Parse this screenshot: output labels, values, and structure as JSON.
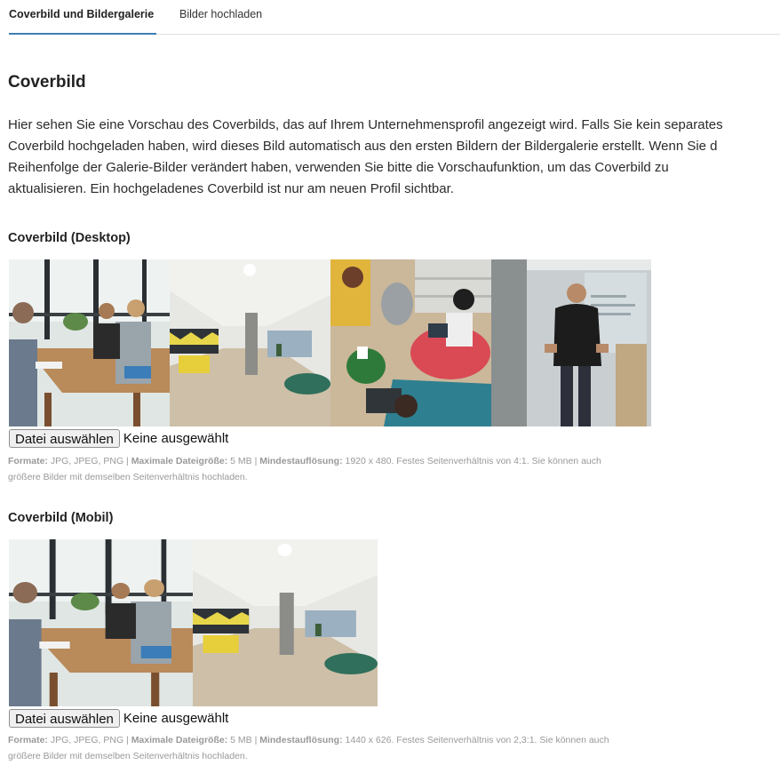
{
  "tabs": [
    {
      "label": "Coverbild und Bildergalerie",
      "active": true
    },
    {
      "label": "Bilder hochladen",
      "active": false
    }
  ],
  "section": {
    "title": "Coverbild",
    "intro_lines": [
      "Hier sehen Sie eine Vorschau des Coverbilds, das auf Ihrem Unternehmensprofil angezeigt wird. Falls Sie kein separates",
      "Coverbild hochgeladen haben, wird dieses Bild automatisch aus den ersten Bildern der Bildergalerie erstellt. Wenn Sie d",
      "Reihenfolge der Galerie-Bilder verändert haben, verwenden Sie bitte die Vorschaufunktion, um das Coverbild zu",
      "aktualisieren. Ein hochgeladenes Coverbild ist nur am neuen Profil sichtbar."
    ]
  },
  "desktop": {
    "title": "Coverbild (Desktop)",
    "images": [
      "meeting-photo",
      "office-hallway-photo",
      "lounge-laptops-photo",
      "presenter-photo"
    ],
    "file_button": "Datei auswählen",
    "file_status": "Keine ausgewählt",
    "hint": {
      "formats_label": "Formate:",
      "formats": " JPG, JPEG, PNG | ",
      "size_label": "Maximale Dateigröße:",
      "size": " 5 MB | ",
      "res_label": "Mindestauflösung:",
      "res_line1": " 1920 x 480. Festes Seitenverhältnis von 4:1. Sie können auch",
      "line2": "größere Bilder mit demselben Seitenverhältnis hochladen."
    }
  },
  "mobile": {
    "title": "Coverbild (Mobil)",
    "images": [
      "meeting-photo",
      "office-hallway-photo"
    ],
    "file_button": "Datei auswählen",
    "file_status": "Keine ausgewählt",
    "hint": {
      "formats_label": "Formate:",
      "formats": " JPG, JPEG, PNG | ",
      "size_label": "Maximale Dateigröße:",
      "size": " 5 MB | ",
      "res_label": "Mindestauflösung:",
      "res_line1": " 1440 x 626. Festes Seitenverhältnis von 2,3:1. Sie können auch",
      "line2": "größere Bilder mit demselben Seitenverhältnis hochladen."
    }
  },
  "colors": {
    "tab_underline": "#3f7fb0",
    "hint_text": "#999999",
    "text": "#222222"
  }
}
